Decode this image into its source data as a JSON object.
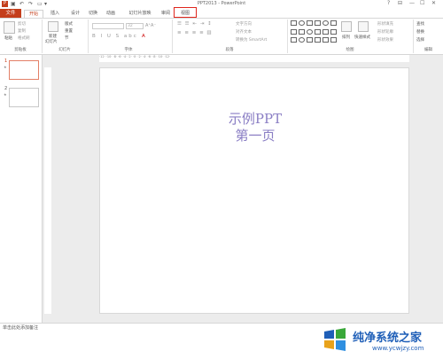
{
  "window": {
    "title": "PPT2013 - PowerPoint",
    "min": "—",
    "max": "☐",
    "close": "✕",
    "help": "?",
    "ribbon_opt": "⊟"
  },
  "tabs": [
    {
      "label": "文件"
    },
    {
      "label": "开始"
    },
    {
      "label": "插入"
    },
    {
      "label": "设计"
    },
    {
      "label": "切换"
    },
    {
      "label": "动画"
    },
    {
      "label": "幻灯片放映"
    },
    {
      "label": "审阅"
    },
    {
      "label": "视图"
    }
  ],
  "ribbon": {
    "clipboard": {
      "paste": "粘贴",
      "cut": "剪切",
      "copy": "复制",
      "painter": "格式刷",
      "label": "剪贴板"
    },
    "slides": {
      "new_slide": "新建",
      "new_slide2": "幻灯片",
      "layout": "版式",
      "reset": "重置",
      "section": "节",
      "label": "幻灯片"
    },
    "font": {
      "label": "字体",
      "size_value": "32"
    },
    "paragraph": {
      "label": "段落",
      "text_dir": "文字方向",
      "align_text": "对齐文本",
      "smartart": "转换为 SmartArt"
    },
    "drawing": {
      "label": "绘图",
      "arrange": "排列",
      "quick_styles": "快速样式",
      "fill": "形状填充",
      "outline": "形状轮廓",
      "effects": "形状效果"
    },
    "editing": {
      "label": "编辑",
      "find": "查找",
      "replace": "替换",
      "select": "选择"
    }
  },
  "thumbnails": [
    {
      "number": "1",
      "star": "★"
    },
    {
      "number": "2",
      "star": "★"
    }
  ],
  "slide": {
    "title_line1": "示例PPT",
    "title_line2": "第一页"
  },
  "ruler": {
    "labels": "·12· ·10· ·8· ·6· ·4· ·2· ·0· ·2· ·4· ·6· ·8· ·10· ·12·"
  },
  "status": {
    "notes": "单击此处添加备注"
  },
  "watermark": {
    "name": "纯净系统之家",
    "url": "www.ycwjzy.com"
  },
  "colors": {
    "accent": "#c43e1c",
    "highlight": "#e0261d",
    "slide_text": "#8a7ec4"
  }
}
